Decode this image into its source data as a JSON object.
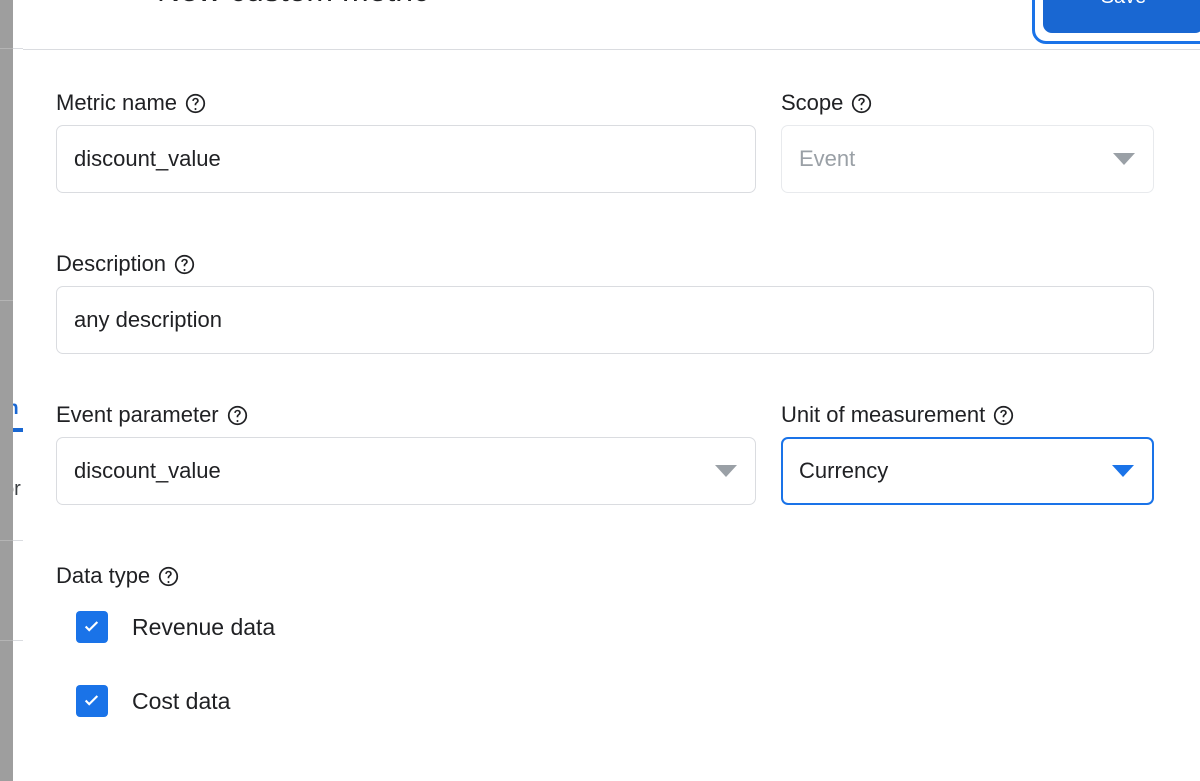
{
  "background_page": {
    "tab_label_fragment": "n",
    "body_text_fragment": "or"
  },
  "dialog": {
    "title": "New custom metric",
    "close_icon": "close-icon",
    "save_label": "Save",
    "accent_color": "#1a73e8",
    "button_color": "#1967d2"
  },
  "fields": {
    "metric_name": {
      "label": "Metric name",
      "help_icon": "help-circle-icon",
      "value": "discount_value",
      "placeholder": "Metric name"
    },
    "scope": {
      "label": "Scope",
      "help_icon": "help-circle-icon",
      "value": "Event",
      "disabled": true
    },
    "description": {
      "label": "Description",
      "help_icon": "help-circle-icon",
      "value": "any description",
      "placeholder": "Description"
    },
    "event_parameter": {
      "label": "Event parameter",
      "help_icon": "help-circle-icon",
      "value": "discount_value"
    },
    "unit_of_measurement": {
      "label": "Unit of measurement",
      "help_icon": "help-circle-icon",
      "value": "Currency",
      "focused": true
    },
    "data_type": {
      "label": "Data type",
      "help_icon": "help-circle-icon",
      "options": [
        {
          "label": "Revenue data",
          "checked": true
        },
        {
          "label": "Cost data",
          "checked": true
        }
      ]
    }
  }
}
